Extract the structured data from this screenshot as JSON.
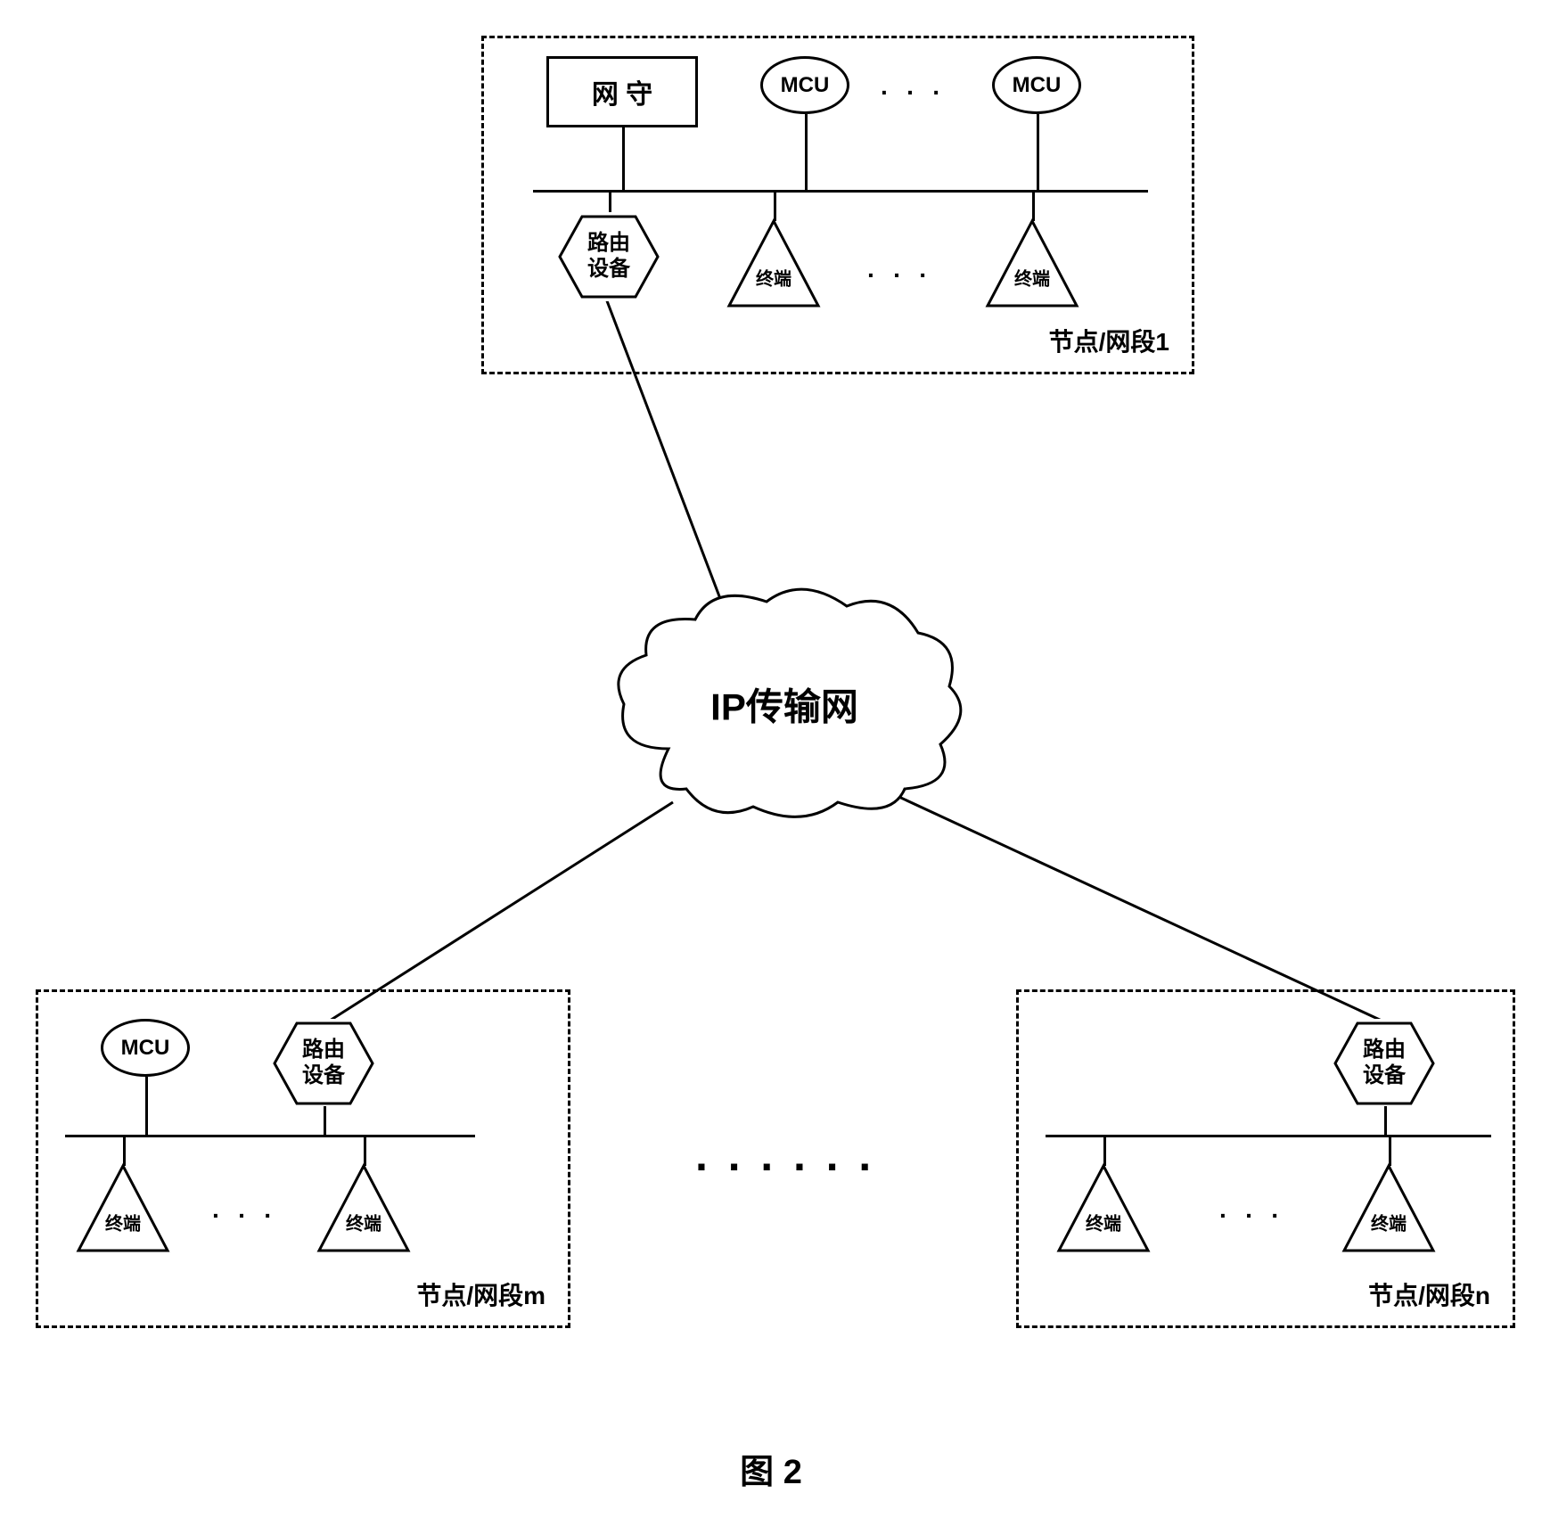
{
  "node1": {
    "label": "节点/网段1",
    "gatekeeper": "网 守",
    "mcu1": "MCU",
    "mcu2": "MCU",
    "router": "路由\n设备",
    "terminal1": "终端",
    "terminal2": "终端",
    "dots_top": "· · ·",
    "dots_bottom": "· · ·"
  },
  "node_m": {
    "label": "节点/网段m",
    "mcu": "MCU",
    "router": "路由\n设备",
    "terminal1": "终端",
    "terminal2": "终端",
    "dots": "· · ·"
  },
  "node_n": {
    "label": "节点/网段n",
    "router": "路由\n设备",
    "terminal1": "终端",
    "terminal2": "终端",
    "dots": "· · ·"
  },
  "cloud_label": "IP传输网",
  "middle_dots": "······",
  "figure_label": "图 2"
}
